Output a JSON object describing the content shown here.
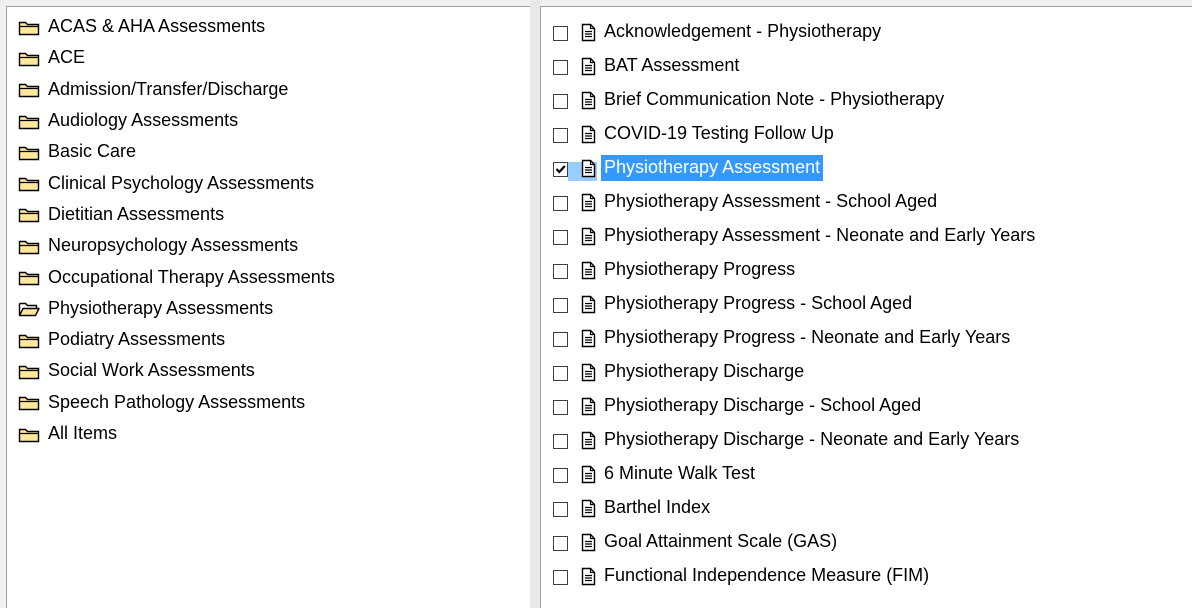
{
  "categories": [
    {
      "label": "ACAS & AHA Assessments",
      "open": false
    },
    {
      "label": "ACE",
      "open": false
    },
    {
      "label": "Admission/Transfer/Discharge",
      "open": false
    },
    {
      "label": "Audiology Assessments",
      "open": false
    },
    {
      "label": "Basic Care",
      "open": false
    },
    {
      "label": "Clinical Psychology Assessments",
      "open": false
    },
    {
      "label": "Dietitian Assessments",
      "open": false
    },
    {
      "label": "Neuropsychology Assessments",
      "open": false
    },
    {
      "label": "Occupational Therapy Assessments",
      "open": false
    },
    {
      "label": "Physiotherapy Assessments",
      "open": true
    },
    {
      "label": "Podiatry Assessments",
      "open": false
    },
    {
      "label": "Social Work Assessments",
      "open": false
    },
    {
      "label": "Speech Pathology Assessments",
      "open": false
    },
    {
      "label": "All Items",
      "open": false
    }
  ],
  "items": [
    {
      "label": "Acknowledgement - Physiotherapy",
      "checked": false,
      "selected": false
    },
    {
      "label": "BAT Assessment",
      "checked": false,
      "selected": false
    },
    {
      "label": "Brief Communication Note - Physiotherapy",
      "checked": false,
      "selected": false
    },
    {
      "label": "COVID-19 Testing Follow Up",
      "checked": false,
      "selected": false
    },
    {
      "label": "Physiotherapy Assessment",
      "checked": true,
      "selected": true
    },
    {
      "label": "Physiotherapy Assessment - School Aged",
      "checked": false,
      "selected": false
    },
    {
      "label": "Physiotherapy Assessment - Neonate and Early Years",
      "checked": false,
      "selected": false
    },
    {
      "label": "Physiotherapy Progress",
      "checked": false,
      "selected": false
    },
    {
      "label": "Physiotherapy Progress - School Aged",
      "checked": false,
      "selected": false
    },
    {
      "label": "Physiotherapy Progress - Neonate and Early Years",
      "checked": false,
      "selected": false
    },
    {
      "label": "Physiotherapy Discharge",
      "checked": false,
      "selected": false
    },
    {
      "label": "Physiotherapy Discharge - School Aged",
      "checked": false,
      "selected": false
    },
    {
      "label": "Physiotherapy Discharge - Neonate and Early Years",
      "checked": false,
      "selected": false
    },
    {
      "label": "6 Minute Walk Test",
      "checked": false,
      "selected": false
    },
    {
      "label": "Barthel Index",
      "checked": false,
      "selected": false
    },
    {
      "label": "Goal Attainment Scale (GAS)",
      "checked": false,
      "selected": false
    },
    {
      "label": "Functional Independence Measure (FIM)",
      "checked": false,
      "selected": false
    }
  ],
  "colors": {
    "selection": "#3399ff",
    "folder_fill": "#ffe79c",
    "folder_stroke": "#000000"
  },
  "icons": {
    "folder_closed": "folder-icon",
    "folder_open": "folder-open-icon",
    "document": "document-icon",
    "checkmark": "checkmark-icon"
  }
}
